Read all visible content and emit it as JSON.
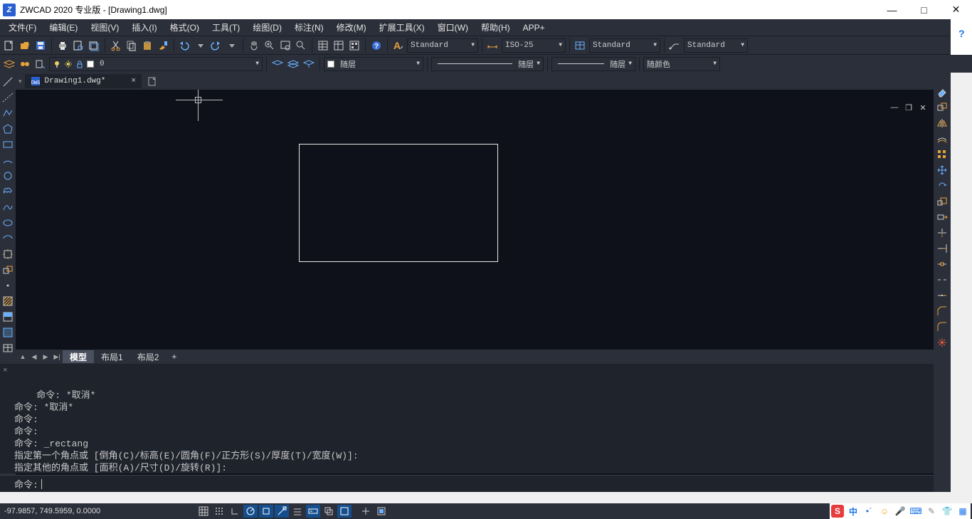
{
  "title": "ZWCAD 2020 专业版 - [Drawing1.dwg]",
  "app_icon_letter": "Z",
  "help_q": "?",
  "menus": [
    "文件(F)",
    "编辑(E)",
    "视图(V)",
    "插入(I)",
    "格式(O)",
    "工具(T)",
    "绘图(D)",
    "标注(N)",
    "修改(M)",
    "扩展工具(X)",
    "窗口(W)",
    "帮助(H)",
    "APP+"
  ],
  "style_combos": {
    "text_style": "Standard",
    "dim_style": "ISO-25",
    "table_style": "Standard",
    "mleader_style": "Standard"
  },
  "layer_row": {
    "current_layer": "0",
    "prop_color": "随层",
    "prop_linetype": "随层",
    "prop_lineweight": "随层",
    "prop_plotcolor": "随颜色"
  },
  "file_tab": "Drawing1.dwg*",
  "layout_tabs": {
    "model": "模型",
    "layout1": "布局1",
    "layout2": "布局2",
    "add": "+"
  },
  "cmd_history": "命令: *取消*\n命令: *取消*\n命令:\n命令:\n命令: _rectang\n指定第一个角点或 [倒角(C)/标高(E)/圆角(F)/正方形(S)/厚度(T)/宽度(W)]:\n指定其他的角点或 [面积(A)/尺寸(D)/旋转(R)]:",
  "cmd_prompt": "命令:",
  "coords": "-97.9857, 749.5959, 0.0000",
  "tray_cn": "中",
  "win_min": "—",
  "win_max": "□",
  "win_close": "✕",
  "file_close": "×",
  "inner_min": "—",
  "inner_max": "❐",
  "inner_close": "✕",
  "tri_marker": "▼",
  "pin": "▾"
}
